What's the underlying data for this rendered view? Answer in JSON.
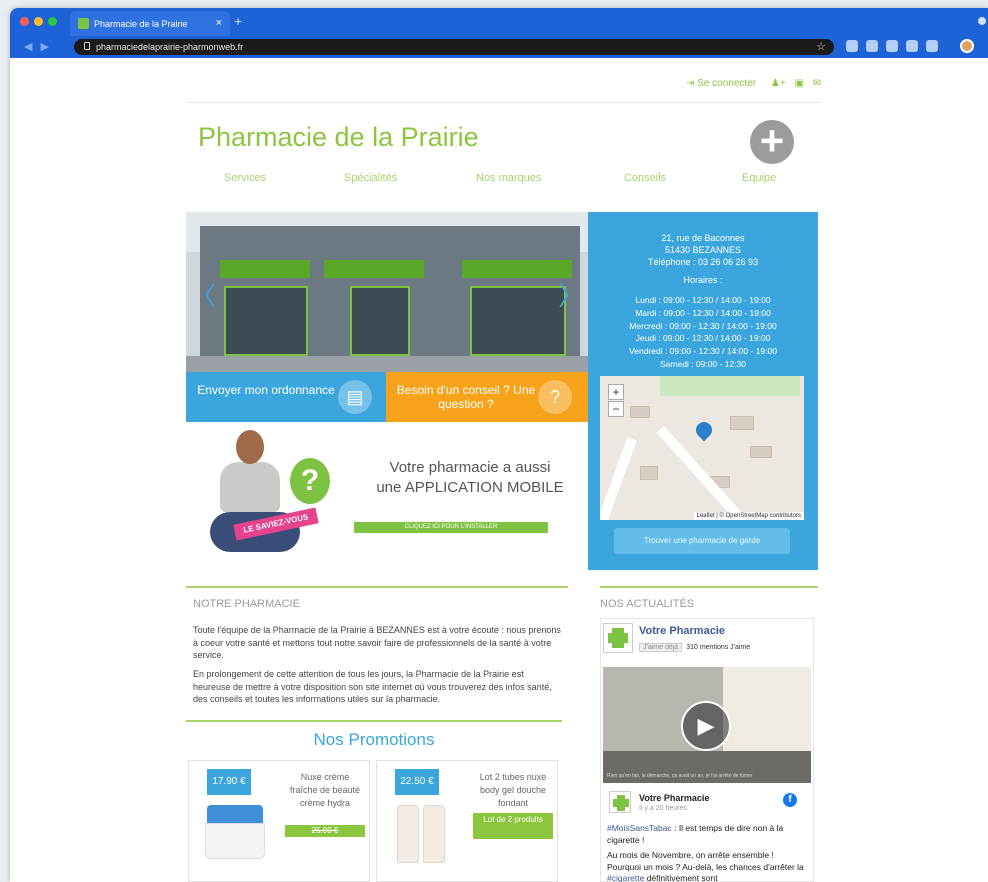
{
  "browser": {
    "tab_title": "Pharmacie de la Prairie",
    "tab_close": "×",
    "new_tab": "+",
    "url": "pharmaciedelaprairie-pharmonweb.fr",
    "star": "☆"
  },
  "header": {
    "login": "Se connecter",
    "brand": "Pharmacie de la Prairie",
    "plus": "+"
  },
  "nav": [
    "Services",
    "Spécialités",
    "Nos marques",
    "Conseils",
    "Equipe"
  ],
  "hero": {
    "prev": "〈",
    "next": "〉"
  },
  "info": {
    "address1": "21, rue de Baconnes",
    "address2": "51430 BEZANNES",
    "phone": "Téléphone : 03 26 06 26 93",
    "hours_title": "Horaires :",
    "hours": [
      "Lundi : 09:00 - 12:30 / 14:00 - 19:00",
      "Mardi : 09:00 - 12:30 / 14:00 - 19:00",
      "Mercredi : 09:00 - 12:30 / 14:00 - 19:00",
      "Jeudi : 09:00 - 12:30 / 14:00 - 19:00",
      "Vendredi : 09:00 - 12:30 / 14:00 - 19:00",
      "Samedi : 09:00 - 12:30"
    ],
    "zoom_in": "+",
    "zoom_out": "−",
    "map_attr": "Leaflet | © OpenStreetMap contributors",
    "garde_button": "Trouver une pharmacie de garde"
  },
  "cta": {
    "ordonnance": "Envoyer mon ordonnance",
    "conseil": "Besoin d'un conseil ? Une question ?",
    "conseil_icon": "?",
    "ordonnance_icon": "▤"
  },
  "app_promo": {
    "badge": "LE SAVIEZ-VOUS",
    "question": "?",
    "line1": "Votre pharmacie a aussi",
    "line2": "une APPLICATION MOBILE",
    "download": "CLIQUEZ ICI POUR L'INSTALLER"
  },
  "notre_pharmacie": {
    "title": "NOTRE PHARMACIE",
    "p1": "Toute l'équipe de la Pharmacie de la Prairie à BEZANNES est à votre écoute : nous prenons à coeur votre santé et mettons tout notre savoir faire de professionnels de la santé à votre service.",
    "p2": "En prolongement de cette attention de tous les jours, la Pharmacie de la Prairie est heureuse de mettre à votre disposition son site internet où vous trouverez des infos santé, des conseils et toutes les informations utiles sur la pharmacie."
  },
  "promotions": {
    "title": "Nos Promotions",
    "items": [
      {
        "price": "17.90 €",
        "name": "Nuxe crème fraîche de beauté crème hydra",
        "old_price": "25.00 €",
        "tag": ""
      },
      {
        "price": "22.50 €",
        "name": "Lot 2 tubes nuxe body gel douche fondant",
        "old_price": "",
        "tag": "Lot de 2 produits"
      }
    ]
  },
  "actualites": {
    "title": "NOS ACTUALITÉS",
    "page_name": "Votre Pharmacie",
    "like_button": "J'aime déjà",
    "likes": "310 mentions J'aime",
    "video_caption": "Rien qu'en fait, la démarche, ça avait un an, je l'ai arrêté de fumer",
    "play": "▶",
    "post_name": "Votre Pharmacie",
    "post_time": "Il y a 20 heures",
    "fb_icon": "f",
    "hashtag1": "#MoisSansTabac",
    "text1": " : Il est temps de dire non à la cigarette !",
    "text2": "Au mois de Novembre, on arrête ensemble ! Pourquoi un mois ? Au-delà, les chances d'arrêter la ",
    "hashtag2": "#cigarette",
    "text3": " définitivement sont"
  },
  "colors": {
    "green": "#8cc63f",
    "blue": "#3aa6dd",
    "orange": "#f7a21b",
    "chrome": "#1d62d6"
  }
}
